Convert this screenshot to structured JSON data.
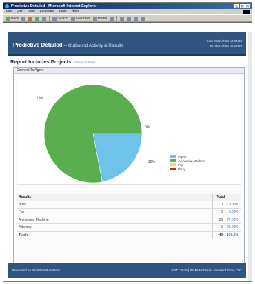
{
  "window": {
    "title": "Predictive Detailed - Microsoft Internet Explorer"
  },
  "menu": [
    "File",
    "Edit",
    "View",
    "Favorites",
    "Tools",
    "Help"
  ],
  "toolbar": {
    "back": "Back",
    "search": "Search",
    "favorites": "Favorites",
    "media": "Media"
  },
  "header": {
    "title": "Predictive Detailed",
    "subtitle": "-- Outbound Activity & Results",
    "date_from": "from 09/01/2003 at 00:00",
    "date_to": "to 09/01/2003 at 23:59"
  },
  "report": {
    "heading": "Report Includes Projects",
    "link": "Outbound Sales"
  },
  "panel": {
    "title": "Connect To Agent"
  },
  "colors": {
    "green": "#5aae4f",
    "blue": "#6fc3e8",
    "yellow": "#f2e35b",
    "red": "#d0262b",
    "header_bg": "#2f5580"
  },
  "chart_data": {
    "type": "pie",
    "categories": [
      "Agent",
      "Answering Machine",
      "Fax",
      "Busy"
    ],
    "values": [
      22,
      78,
      0,
      0
    ],
    "slice_labels": [
      "22%",
      "78%",
      "0%"
    ],
    "legend_position": "right"
  },
  "legend": [
    {
      "label": "Agent",
      "color": "#6fc3e8"
    },
    {
      "label": "Answering Machine",
      "color": "#5aae4f"
    },
    {
      "label": "Fax",
      "color": "#f2e35b"
    },
    {
      "label": "Busy",
      "color": "#d0262b"
    }
  ],
  "results": {
    "col_results": "Results",
    "col_total": "Total",
    "rows": [
      {
        "label": "Busy",
        "count": "0",
        "pct": "0.00%"
      },
      {
        "label": "Fax",
        "count": "0",
        "pct": "0.00%"
      },
      {
        "label": "Answering Machine",
        "count": "36",
        "pct": "77.00%"
      },
      {
        "label": "Attorney",
        "count": "0",
        "pct": "22.00%"
      }
    ],
    "total": {
      "label": "Totals",
      "count": "45",
      "pct": "100.0%"
    }
  },
  "footer": {
    "left": "Generated on 09/18/2003 at 16:21",
    "right": "(GMT-08:00) 07:48:18 Pacific Standard Time, PST"
  }
}
